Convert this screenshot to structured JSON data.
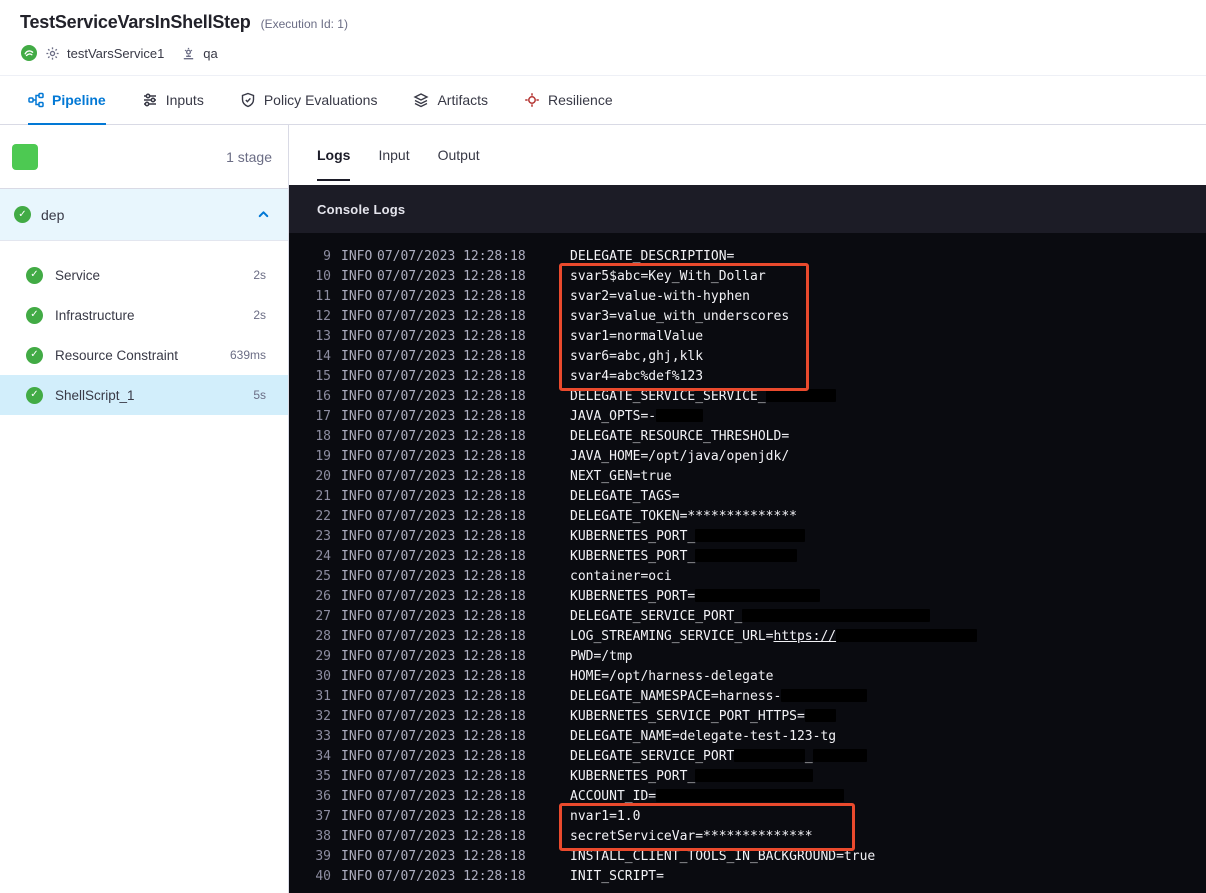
{
  "colors": {
    "accent_blue": "#0278d5",
    "success_green": "#42ab45",
    "stage_green": "#4dc952",
    "highlight_red": "#ea4a2d",
    "console_bg": "#0a0b10",
    "console_header_bg": "#1c1c26"
  },
  "header": {
    "title": "TestServiceVarsInShellStep",
    "execution_id": "(Execution Id: 1)",
    "service_name": "testVarsService1",
    "environment_name": "qa"
  },
  "nav_tabs": [
    {
      "label": "Pipeline"
    },
    {
      "label": "Inputs"
    },
    {
      "label": "Policy Evaluations"
    },
    {
      "label": "Artifacts"
    },
    {
      "label": "Resilience"
    }
  ],
  "sidebar": {
    "stage_count": "1 stage",
    "stage_name": "dep",
    "steps": [
      {
        "name": "Service",
        "duration": "2s"
      },
      {
        "name": "Infrastructure",
        "duration": "2s"
      },
      {
        "name": "Resource Constraint",
        "duration": "639ms"
      },
      {
        "name": "ShellScript_1",
        "duration": "5s",
        "selected": true
      }
    ]
  },
  "log_tabs": [
    {
      "label": "Logs",
      "active": true
    },
    {
      "label": "Input"
    },
    {
      "label": "Output"
    }
  ],
  "console": {
    "title": "Console Logs",
    "level": "INFO",
    "timestamp": "07/07/2023 12:28:18",
    "lines": [
      {
        "num": 9,
        "msg": [
          {
            "t": "DELEGATE_DESCRIPTION="
          }
        ]
      },
      {
        "num": 10,
        "hl": 1,
        "msg": [
          {
            "t": "svar5$abc=Key_With_Dollar"
          }
        ]
      },
      {
        "num": 11,
        "hl": 1,
        "msg": [
          {
            "t": "svar2=value-with-hyphen"
          }
        ]
      },
      {
        "num": 12,
        "hl": 1,
        "msg": [
          {
            "t": "svar3=value_with_underscores"
          }
        ]
      },
      {
        "num": 13,
        "hl": 1,
        "msg": [
          {
            "t": "svar1=normalValue"
          }
        ]
      },
      {
        "num": 14,
        "hl": 1,
        "msg": [
          {
            "t": "svar6=abc,ghj,klk"
          }
        ]
      },
      {
        "num": 15,
        "hl": 1,
        "msg": [
          {
            "t": "svar4=abc%def%123"
          }
        ]
      },
      {
        "num": 16,
        "msg": [
          {
            "t": "DELEGATE_SERVICE_SERVICE_"
          },
          {
            "r": 9
          }
        ]
      },
      {
        "num": 17,
        "msg": [
          {
            "t": "JAVA_OPTS=-"
          },
          {
            "r": 6
          }
        ]
      },
      {
        "num": 18,
        "msg": [
          {
            "t": "DELEGATE_RESOURCE_THRESHOLD="
          }
        ]
      },
      {
        "num": 19,
        "msg": [
          {
            "t": "JAVA_HOME=/opt/java/openjdk/"
          }
        ]
      },
      {
        "num": 20,
        "msg": [
          {
            "t": "NEXT_GEN=true"
          }
        ]
      },
      {
        "num": 21,
        "msg": [
          {
            "t": "DELEGATE_TAGS="
          }
        ]
      },
      {
        "num": 22,
        "msg": [
          {
            "t": "DELEGATE_TOKEN=**************"
          }
        ]
      },
      {
        "num": 23,
        "msg": [
          {
            "t": "KUBERNETES_PORT_"
          },
          {
            "r": 14
          }
        ]
      },
      {
        "num": 24,
        "msg": [
          {
            "t": "KUBERNETES_PORT_"
          },
          {
            "r": 13
          }
        ]
      },
      {
        "num": 25,
        "msg": [
          {
            "t": "container=oci"
          }
        ]
      },
      {
        "num": 26,
        "msg": [
          {
            "t": "KUBERNETES_PORT="
          },
          {
            "r": 16
          }
        ]
      },
      {
        "num": 27,
        "msg": [
          {
            "t": "DELEGATE_SERVICE_PORT_"
          },
          {
            "r": 24
          }
        ]
      },
      {
        "num": 28,
        "msg": [
          {
            "t": "LOG_STREAMING_SERVICE_URL="
          },
          {
            "link": "https://"
          },
          {
            "r": 18
          }
        ]
      },
      {
        "num": 29,
        "msg": [
          {
            "t": "PWD=/tmp"
          }
        ]
      },
      {
        "num": 30,
        "msg": [
          {
            "t": "HOME=/opt/harness-delegate"
          }
        ]
      },
      {
        "num": 31,
        "msg": [
          {
            "t": "DELEGATE_NAMESPACE=harness-"
          },
          {
            "r": 11
          }
        ]
      },
      {
        "num": 32,
        "msg": [
          {
            "t": "KUBERNETES_SERVICE_PORT_HTTPS="
          },
          {
            "r": 4
          }
        ]
      },
      {
        "num": 33,
        "msg": [
          {
            "t": "DELEGATE_NAME=delegate-test-123-tg"
          }
        ]
      },
      {
        "num": 34,
        "msg": [
          {
            "t": "DELEGATE_SERVICE_PORT"
          },
          {
            "r": 9
          },
          {
            "t": "_"
          },
          {
            "r": 7
          }
        ]
      },
      {
        "num": 35,
        "msg": [
          {
            "t": "KUBERNETES_PORT_"
          },
          {
            "r": 15
          }
        ]
      },
      {
        "num": 36,
        "msg": [
          {
            "t": "ACCOUNT_ID="
          },
          {
            "r": 24
          }
        ]
      },
      {
        "num": 37,
        "hl": 2,
        "msg": [
          {
            "t": "nvar1=1.0"
          }
        ]
      },
      {
        "num": 38,
        "hl": 2,
        "msg": [
          {
            "t": "secretServiceVar=**************"
          }
        ]
      },
      {
        "num": 39,
        "msg": [
          {
            "t": "INSTALL_CLIENT_TOOLS_IN_BACKGROUND=true"
          }
        ]
      },
      {
        "num": 40,
        "msg": [
          {
            "t": "INIT_SCRIPT="
          }
        ]
      }
    ]
  }
}
